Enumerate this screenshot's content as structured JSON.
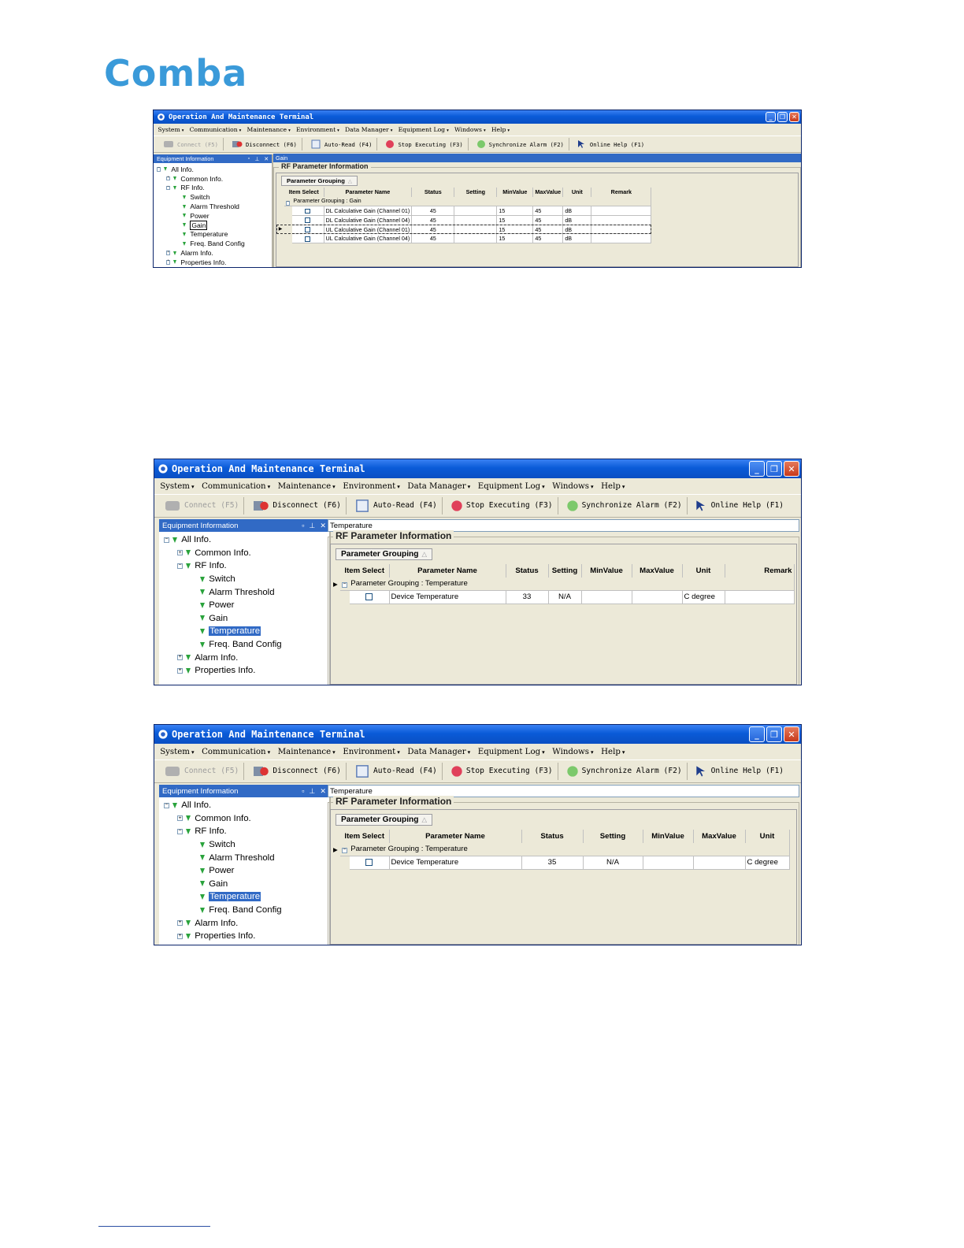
{
  "logo": {
    "text": "Comba"
  },
  "windows": [
    {
      "title": "Operation And Maintenance Terminal",
      "menu": [
        "System",
        "Communication",
        "Maintenance",
        "Environment",
        "Data Manager",
        "Equipment Log",
        "Windows",
        "Help"
      ],
      "toolbar": [
        "Connect (F5)",
        "Disconnect (F6)",
        "Auto-Read (F4)",
        "Stop Executing (F3)",
        "Synchronize Alarm (F2)",
        "Online Help (F1)"
      ],
      "panel_title": "Equipment Information",
      "tree": [
        "All Info.",
        "Common Info.",
        "RF Info.",
        "Switch",
        "Alarm Threshold",
        "Power",
        "Gain",
        "Temperature",
        "Freq. Band Config",
        "Alarm Info.",
        "Properties Info."
      ],
      "address": "Gain",
      "group_title": "RF Parameter Information",
      "grouping_label": "Parameter Grouping",
      "columns": [
        "Item Select",
        "Parameter Name",
        "Status",
        "Setting",
        "MinValue",
        "MaxValue",
        "Unit",
        "Remark"
      ],
      "group_row": "Parameter Grouping : Gain",
      "rows": [
        [
          "",
          "DL Calculative Gain (Channel 01)",
          "45",
          "",
          "15",
          "45",
          "dB",
          ""
        ],
        [
          "",
          "DL Calculative Gain (Channel 04)",
          "45",
          "",
          "15",
          "45",
          "dB",
          ""
        ],
        [
          "",
          "UL Calculative Gain (Channel 01)",
          "45",
          "",
          "15",
          "45",
          "dB",
          ""
        ],
        [
          "",
          "UL Calculative Gain (Channel 04)",
          "45",
          "",
          "15",
          "45",
          "dB",
          ""
        ]
      ]
    },
    {
      "title": "Operation And Maintenance Terminal",
      "menu": [
        "System",
        "Communication",
        "Maintenance",
        "Environment",
        "Data Manager",
        "Equipment Log",
        "Windows",
        "Help"
      ],
      "toolbar": [
        "Connect (F5)",
        "Disconnect (F6)",
        "Auto-Read (F4)",
        "Stop Executing (F3)",
        "Synchronize Alarm (F2)",
        "Online Help (F1)"
      ],
      "panel_title": "Equipment Information",
      "tree": [
        "All Info.",
        "Common Info.",
        "RF Info.",
        "Switch",
        "Alarm Threshold",
        "Power",
        "Gain",
        "Temperature",
        "Freq. Band Config",
        "Alarm Info.",
        "Properties Info."
      ],
      "address": "Temperature",
      "group_title": "RF Parameter Information",
      "grouping_label": "Parameter Grouping",
      "columns": [
        "Item Select",
        "Parameter Name",
        "Status",
        "Setting",
        "MinValue",
        "MaxValue",
        "Unit",
        "Remark"
      ],
      "group_row": "Parameter Grouping : Temperature",
      "rows": [
        [
          "",
          "Device Temperature",
          "33",
          "N/A",
          "",
          "",
          "C degree",
          ""
        ]
      ]
    },
    {
      "title": "Operation And Maintenance Terminal",
      "menu": [
        "System",
        "Communication",
        "Maintenance",
        "Environment",
        "Data Manager",
        "Equipment Log",
        "Windows",
        "Help"
      ],
      "toolbar": [
        "Connect (F5)",
        "Disconnect (F6)",
        "Auto-Read (F4)",
        "Stop Executing (F3)",
        "Synchronize Alarm (F2)",
        "Online Help (F1)"
      ],
      "panel_title": "Equipment Information",
      "tree": [
        "All Info.",
        "Common Info.",
        "RF Info.",
        "Switch",
        "Alarm Threshold",
        "Power",
        "Gain",
        "Temperature",
        "Freq. Band Config",
        "Alarm Info.",
        "Properties Info."
      ],
      "address": "Temperature",
      "group_title": "RF Parameter Information",
      "grouping_label": "Parameter Grouping",
      "columns": [
        "Item Select",
        "Parameter Name",
        "Status",
        "Setting",
        "MinValue",
        "MaxValue",
        "Unit"
      ],
      "group_row": "Parameter Grouping : Temperature",
      "rows": [
        [
          "",
          "Device Temperature",
          "35",
          "N/A",
          "",
          "",
          "C degree"
        ]
      ]
    }
  ],
  "icons": [
    "app-icon",
    "connect-icon",
    "disconnect-icon",
    "auto-read-icon",
    "stop-icon",
    "synchronize-icon",
    "help-icon",
    "tree-node-icon"
  ]
}
